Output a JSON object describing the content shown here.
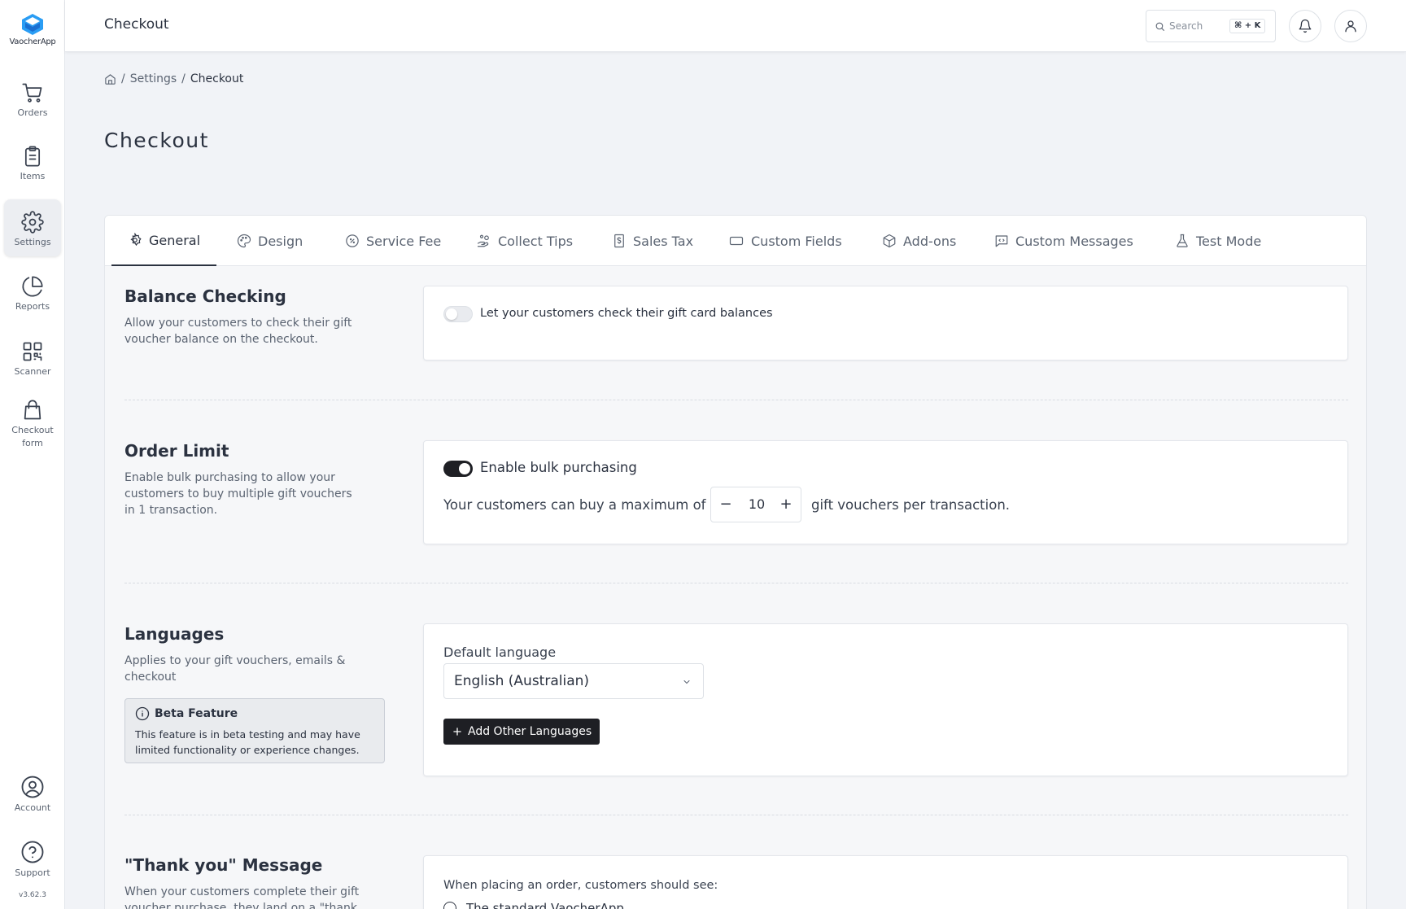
{
  "app": {
    "name": "VaocherApp",
    "version": "v3.62.3"
  },
  "topbar": {
    "title": "Checkout",
    "search_placeholder": "Search",
    "shortcut": "⌘ + K"
  },
  "sidebar": {
    "items": [
      {
        "label": "Orders",
        "icon": "cart-icon"
      },
      {
        "label": "Items",
        "icon": "clipboard-icon"
      },
      {
        "label": "Settings",
        "icon": "gear-icon",
        "active": true
      },
      {
        "label": "Reports",
        "icon": "pie-chart-icon"
      },
      {
        "label": "Scanner",
        "icon": "qr-scanner-icon"
      },
      {
        "label": "Checkout form",
        "icon": "shopping-bag-icon"
      }
    ],
    "bottom_items": [
      {
        "label": "Account",
        "icon": "user-circle-icon"
      },
      {
        "label": "Support",
        "icon": "help-circle-icon"
      }
    ]
  },
  "breadcrumb": {
    "items": [
      "Settings",
      "Checkout"
    ]
  },
  "page": {
    "title": "Checkout"
  },
  "tabs": [
    {
      "label": "General",
      "icon": "gear-icon",
      "active": true
    },
    {
      "label": "Design",
      "icon": "palette-icon"
    },
    {
      "label": "Service Fee",
      "icon": "percent-badge-icon"
    },
    {
      "label": "Collect Tips",
      "icon": "hand-coins-icon"
    },
    {
      "label": "Sales Tax",
      "icon": "receipt-dollar-icon"
    },
    {
      "label": "Custom Fields",
      "icon": "input-field-icon"
    },
    {
      "label": "Add-ons",
      "icon": "package-icon"
    },
    {
      "label": "Custom Messages",
      "icon": "message-square-icon"
    },
    {
      "label": "Test Mode",
      "icon": "flask-icon"
    }
  ],
  "sections": {
    "balance": {
      "title": "Balance Checking",
      "description": "Allow your customers to check their gift voucher balance on the checkout.",
      "toggle_label": "Let your customers check their gift card balances",
      "toggle_on": false
    },
    "order_limit": {
      "title": "Order Limit",
      "description": "Enable bulk purchasing to allow your customers to buy multiple gift vouchers in 1 transaction.",
      "toggle_label": "Enable bulk purchasing",
      "toggle_on": true,
      "prefix": "Your customers can buy a maximum of",
      "value": "10",
      "suffix": "gift vouchers per transaction.",
      "minus": "−",
      "plus": "+"
    },
    "languages": {
      "title": "Languages",
      "description": "Applies to your gift vouchers, emails & checkout",
      "beta_title": "Beta Feature",
      "beta_text": "This feature is in beta testing and may have limited functionality or experience changes.",
      "default_label": "Default language",
      "default_value": "English (Australian)",
      "add_button": "Add Other Languages"
    },
    "thank_you": {
      "title": "\"Thank you\" Message",
      "description": "When your customers complete their gift voucher purchase, they land on a \"thank you\"",
      "prompt": "When placing an order, customers should see:",
      "option_1": "The standard VaocherApp"
    }
  }
}
